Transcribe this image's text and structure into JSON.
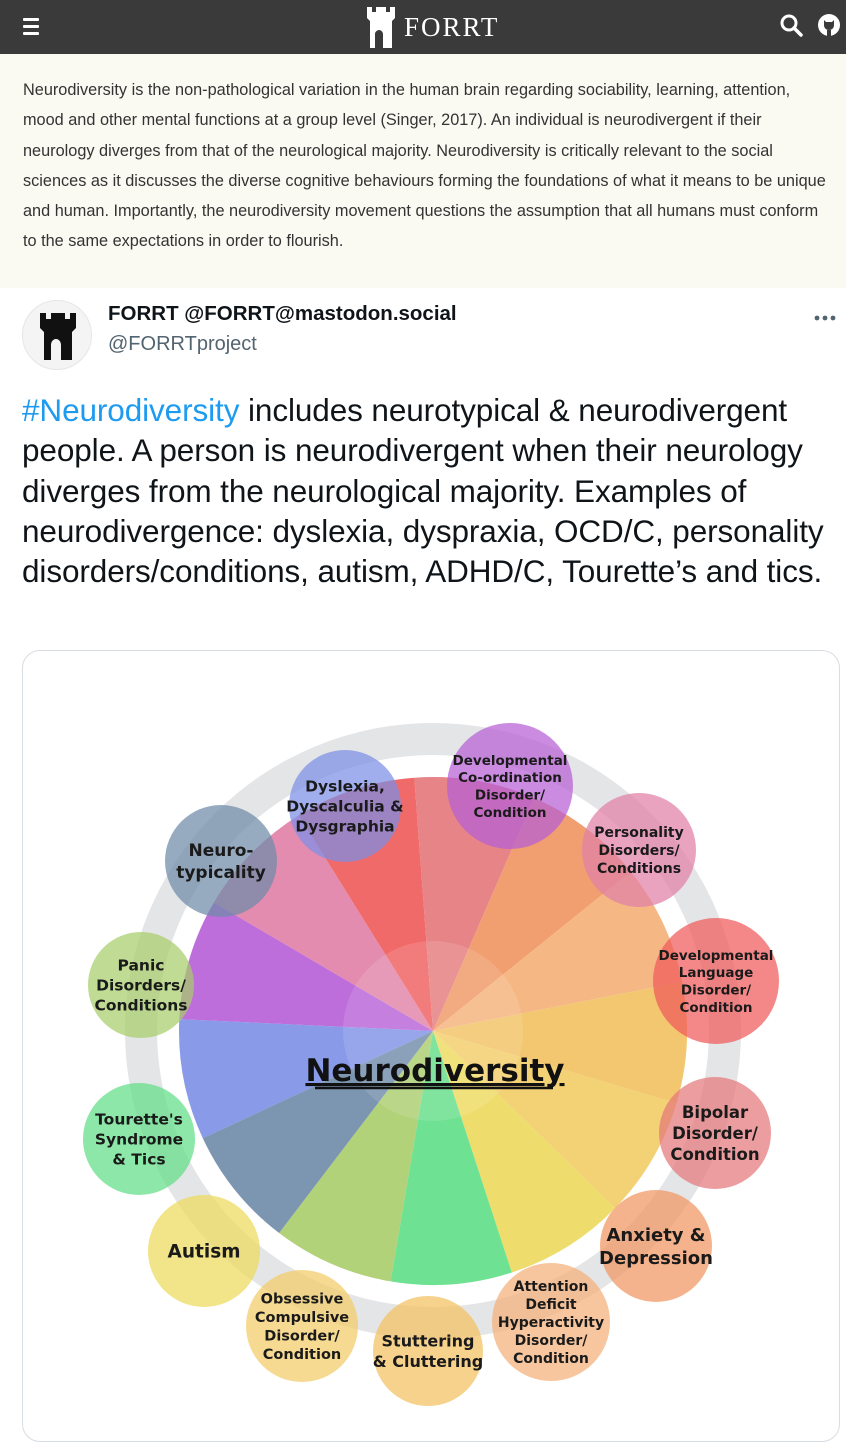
{
  "app": {
    "title": "FORRT",
    "menu_icon": "hamburger-menu-icon",
    "search_icon": "search-icon",
    "github_icon": "github-icon",
    "header_bg": "#3a3a3a"
  },
  "intro_text": "Neurodiversity is the non-pathological variation in the human brain regarding sociability, learning, attention, mood and other mental functions at a group level (Singer, 2017). An individual is neurodivergent if their neurology diverges from that of the neurological majority. Neurodiversity is critically relevant to the social sciences as it discusses the diverse cognitive behaviours forming the foundations of what it means to be unique and human. Importantly, the neurodiversity movement questions the assumption that all humans must conform to the same expectations in order to flourish.",
  "post": {
    "display_name": "FORRT @FORRT@mastodon.social",
    "handle": "@FORRTproject",
    "more_icon": "more-options-icon",
    "hashtag": "#Neurodiversity",
    "body": " includes neurotypical & neurodivergent people. A person is neurodivergent when their neurology diverges from the neurological majority. Examples of neurodivergence: dyslexia, dyspraxia, OCD/C, personality disorders/conditions, autism, ADHD/C, Tourette’s and tics.",
    "link_color": "#1d9bf0"
  },
  "infographic": {
    "center_label": "Neurodiversity",
    "segments": [
      {
        "lines": [
          "Dyslexia,",
          "Dyscalculia &",
          "Dysgraphia"
        ],
        "color": "#7c8fe6"
      },
      {
        "lines": [
          "Developmental",
          "Co-ordination",
          "Disorder/",
          "Condition"
        ],
        "color": "#b65ed6"
      },
      {
        "lines": [
          "Personality",
          "Disorders/",
          "Conditions"
        ],
        "color": "#e17fa6"
      },
      {
        "lines": [
          "Developmental",
          "Language",
          "Disorder/",
          "Condition"
        ],
        "color": "#f05a5a"
      },
      {
        "lines": [
          "Bipolar",
          "Disorder/",
          "Condition"
        ],
        "color": "#e4777a"
      },
      {
        "lines": [
          "Anxiety &",
          "Depression"
        ],
        "color": "#f09560"
      },
      {
        "lines": [
          "Attention",
          "Deficit",
          "Hyperactivity",
          "Disorder/",
          "Condition"
        ],
        "color": "#f4b078"
      },
      {
        "lines": [
          "Stuttering",
          "& Cluttering"
        ],
        "color": "#f2c160"
      },
      {
        "lines": [
          "Obsessive",
          "Compulsive",
          "Disorder/",
          "Condition"
        ],
        "color": "#f2cc66"
      },
      {
        "lines": [
          "Autism"
        ],
        "color": "#ecd95c"
      },
      {
        "lines": [
          "Tourette's",
          "Syndrome",
          "& Tics"
        ],
        "color": "#5fde86"
      },
      {
        "lines": [
          "Panic",
          "Disorders/",
          "Conditions"
        ],
        "color": "#a8cd6a"
      },
      {
        "lines": [
          "Neuro-",
          "typicality"
        ],
        "color": "#6e8aa8"
      }
    ]
  }
}
